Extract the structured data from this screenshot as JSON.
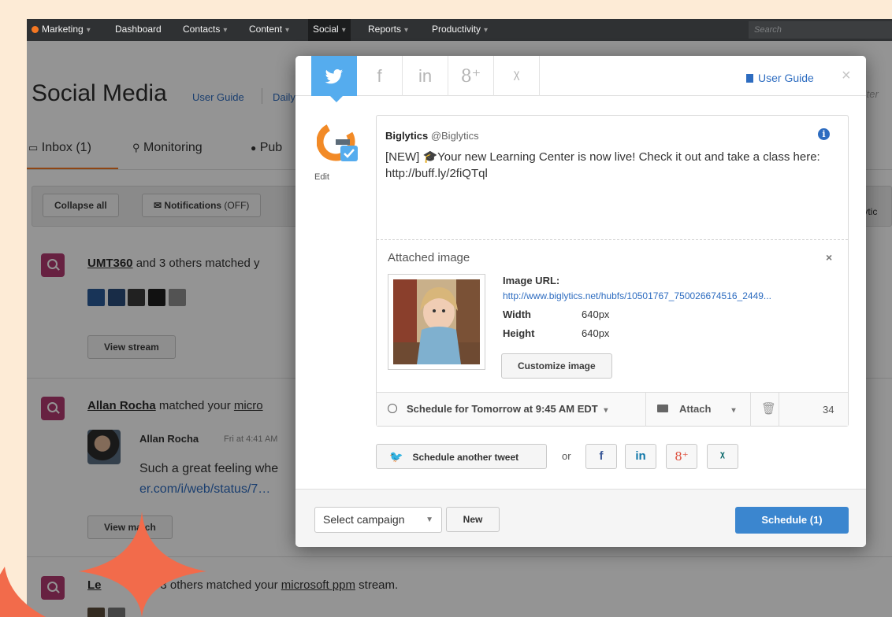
{
  "topnav": {
    "items": [
      {
        "label": "Marketing",
        "caret": "▾"
      },
      {
        "label": "Dashboard",
        "caret": ""
      },
      {
        "label": "Contacts",
        "caret": "▾"
      },
      {
        "label": "Content",
        "caret": "▾"
      },
      {
        "label": "Social",
        "caret": "▾"
      },
      {
        "label": "Reports",
        "caret": "▾"
      },
      {
        "label": "Productivity",
        "caret": "▾"
      }
    ],
    "search_placeholder": "Search"
  },
  "page": {
    "title": "Social Media",
    "user_guide": "User Guide",
    "daily_fragment": "Daily",
    "search_fragment": "Iter",
    "tabs": [
      "Inbox (1)",
      "Monitoring",
      "Pub"
    ],
    "toolbar": {
      "collapse_all": "Collapse all",
      "notifications": "Notifications",
      "notifications_state": "(OFF)",
      "right_fragment": "glytic"
    }
  },
  "feed": {
    "item1": {
      "name": "UMT360",
      "rest": " and 3 others matched y",
      "view": "View stream"
    },
    "item2": {
      "name": "Allan Rocha",
      "rest": " matched your ",
      "link_fragment": "micro",
      "author": "Allan Rocha",
      "time": "Fri at 4:41 AM",
      "body": "Such a great feeling whe",
      "url_fragment": "er.com/i/web/status/7…",
      "view": "View match"
    },
    "item3": {
      "name_fragment": "Le",
      "mid": "nd 3 others matched your ",
      "stream": "microsoft ppm",
      "end": " stream."
    }
  },
  "modal": {
    "networks": [
      "twitter",
      "facebook",
      "linkedin",
      "google-plus",
      "xing"
    ],
    "network_labels": [
      "🐦",
      "f",
      "in",
      "8⁺",
      "ᵡ"
    ],
    "user_guide": "User Guide",
    "close": "×",
    "edit": "Edit",
    "account_name": "Biglytics",
    "account_handle": "@Biglytics",
    "tweet": "[NEW] 🎓Your new Learning Center is now live! Check it out and take a class here: http://buff.ly/2fiQTql",
    "attached_title": "Attached image",
    "attach_close": "×",
    "image_url_label": "Image URL:",
    "image_url": "http://www.biglytics.net/hubfs/10501767_750026674516_2449...",
    "width_label": "Width",
    "width_value": "640px",
    "height_label": "Height",
    "height_value": "640px",
    "customize": "Customize image",
    "schedule_time": "Schedule for Tomorrow at 9:45 AM EDT",
    "schedule_caret": "▾",
    "attach": "Attach",
    "attach_caret": "▾",
    "char_count": "34",
    "schedule_another": "Schedule another tweet",
    "or": "or",
    "share_buttons": [
      "f",
      "in",
      "8⁺",
      "ᵡ"
    ],
    "campaign": "Select campaign",
    "new": "New",
    "schedule": "Schedule (1)"
  },
  "colors": {
    "twitter": "#55acee",
    "facebook": "#3b5998",
    "linkedin": "#0e76a8",
    "google_plus": "#dd4b39",
    "xing": "#026466",
    "primary_button": "#3b86cf",
    "feed_icon": "#b23a70",
    "background": "#fdebd6",
    "star": "#f26b4b"
  }
}
